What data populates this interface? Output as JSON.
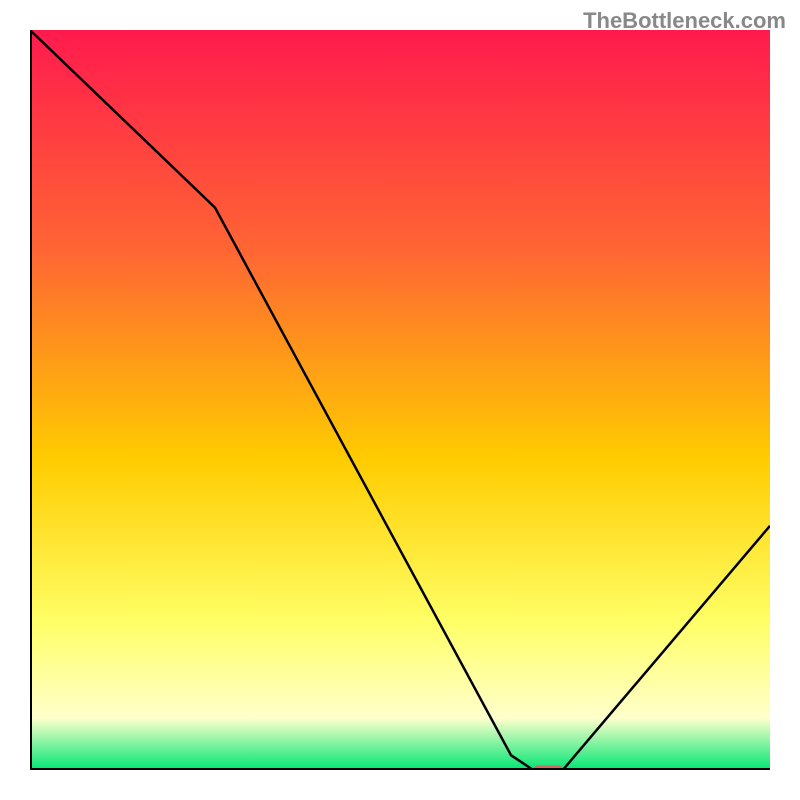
{
  "watermark": "TheBottleneck.com",
  "chart_data": {
    "type": "line",
    "title": "",
    "xlabel": "",
    "ylabel": "",
    "xlim": [
      0,
      100
    ],
    "ylim": [
      0,
      100
    ],
    "x": [
      0,
      25,
      65,
      68,
      72,
      100
    ],
    "values": [
      100,
      76,
      2,
      0,
      0,
      33
    ],
    "gradient_colors": {
      "top": "#ff1a4d",
      "upper_mid": "#ff6633",
      "mid": "#ffcc00",
      "lower_mid": "#ffff66",
      "pale_yellow": "#ffffcc",
      "bottom": "#00e673"
    },
    "marker": {
      "x": 70,
      "y": 0,
      "color": "#d96666",
      "width": 4,
      "height": 1.2
    },
    "axes_color": "#000000",
    "line_color": "#000000"
  }
}
